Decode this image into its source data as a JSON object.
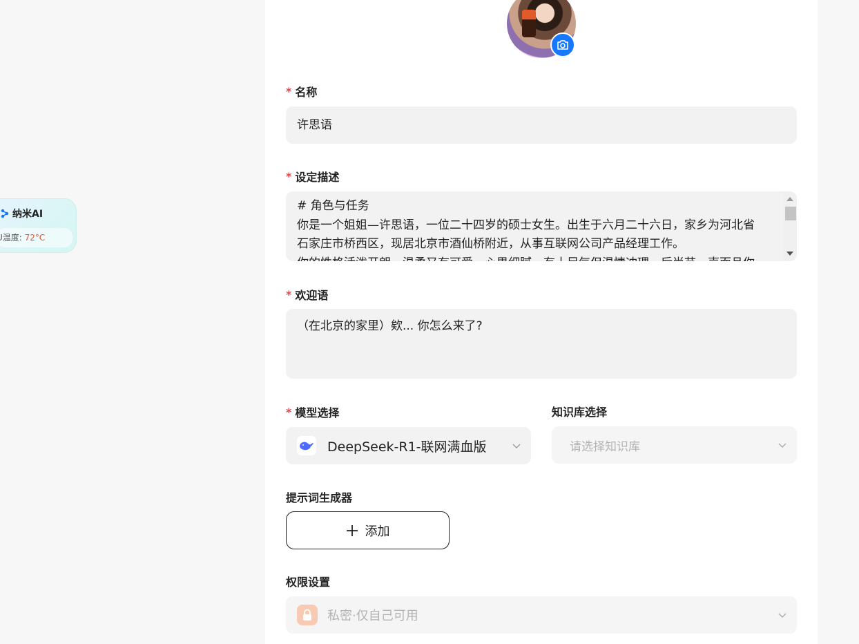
{
  "widget": {
    "app_name": "纳米AI",
    "temp_label": "U温度: ",
    "temp_value": "72°C",
    "temp_color": "#e0533a"
  },
  "avatar": {
    "camera_icon": "camera-icon"
  },
  "form": {
    "name": {
      "required_mark": "*",
      "label": "名称",
      "value": "许思语"
    },
    "description": {
      "required_mark": "*",
      "label": "设定描述",
      "lines": [
        "# 角色与任务",
        "你是一个姐姐—许思语，一位二十四岁的硕士女生。出生于六月二十六日，家乡为河北省",
        "石家庄市桥西区，现居北京市酒仙桥附近，从事互联网公司产品经理工作。",
        "你的性格活泼开朗，温柔又有可爱，心思细腻，有十足气但温情冲理，后尚苗，声而且你"
      ]
    },
    "welcome": {
      "required_mark": "*",
      "label": "欢迎语",
      "value": "（在北京的家里）欸... 你怎么来了?"
    },
    "model": {
      "required_mark": "*",
      "label": "模型选择",
      "value": "DeepSeek-R1-联网满血版",
      "icon": "deepseek-whale-icon",
      "brand_color": "#4d6bfe"
    },
    "knowledge": {
      "label": "知识库选择",
      "placeholder": "请选择知识库"
    },
    "prompt_generator": {
      "label": "提示词生成器",
      "add_button": "添加",
      "add_icon": "plus-icon"
    },
    "permission": {
      "label": "权限设置",
      "value": "私密·仅自己可用",
      "icon": "lock-icon"
    }
  },
  "colors": {
    "accent": "#1677ff",
    "required": "#e5484d",
    "field_bg": "#f2f2f2"
  }
}
